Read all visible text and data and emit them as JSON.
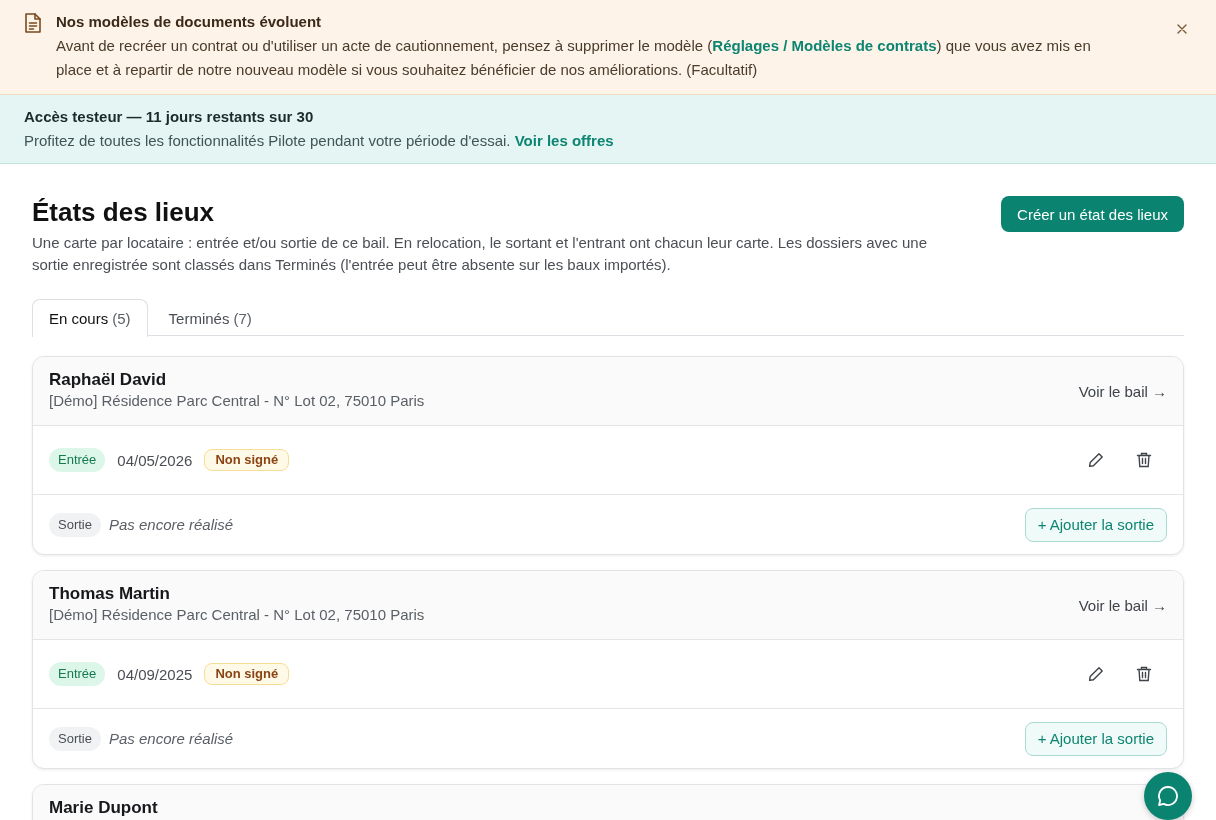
{
  "notice": {
    "title": "Nos modèles de documents évoluent",
    "text_before": "Avant de recréer un contrat ou d'utiliser un acte de cautionnement, pensez à supprimer le modèle (",
    "link": "Réglages / Modèles de contrats",
    "text_after": ") que vous avez mis en place et à repartir de notre nouveau modèle si vous souhaitez bénéficier de nos améliorations. (Facultatif)"
  },
  "trial": {
    "title": "Accès testeur — 11 jours restants sur 30",
    "text": "Profitez de toutes les fonctionnalités Pilote pendant votre période d'essai.",
    "link": "Voir les offres"
  },
  "page": {
    "title": "États des lieux",
    "description": "Une carte par locataire : entrée et/ou sortie de ce bail. En relocation, le sortant et l'entrant ont chacun leur carte. Les dossiers avec une sortie enregistrée sont classés dans Terminés (l'entrée peut être absente sur les baux importés).",
    "create_button": "Créer un état des lieux"
  },
  "tabs": [
    {
      "label": "En cours",
      "count": "(5)",
      "selected": true
    },
    {
      "label": "Terminés",
      "count": "(7)",
      "selected": false
    }
  ],
  "cards": [
    {
      "tenant": "Raphaël David",
      "address": "[Démo] Résidence Parc Central - N° Lot 02, 75010 Paris",
      "lease_link": "Voir le bail →",
      "rows": [
        {
          "kind": "entry",
          "label": "Entrée",
          "date": "04/05/2026",
          "status": "Non signé"
        },
        {
          "kind": "exit",
          "label": "Sortie",
          "note": "Pas encore réalisé",
          "action": "+ Ajouter la sortie"
        }
      ]
    },
    {
      "tenant": "Thomas Martin",
      "address": "[Démo] Résidence Parc Central - N° Lot 02, 75010 Paris",
      "lease_link": "Voir le bail →",
      "rows": [
        {
          "kind": "entry",
          "label": "Entrée",
          "date": "04/09/2025",
          "status": "Non signé"
        },
        {
          "kind": "exit",
          "label": "Sortie",
          "note": "Pas encore réalisé",
          "action": "+ Ajouter la sortie"
        }
      ]
    },
    {
      "tenant": "Marie Dupont"
    }
  ]
}
